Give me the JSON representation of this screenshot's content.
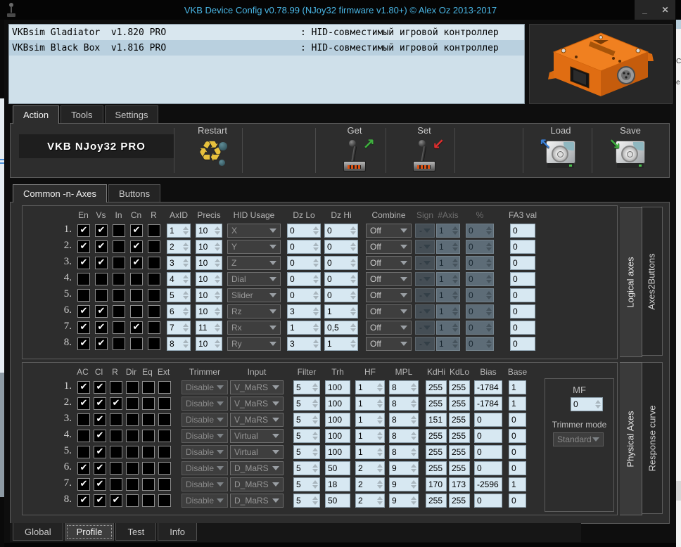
{
  "window": {
    "title": "VKB Device Config v0.78.99 (NJoy32 firmware v1.80+) © Alex Oz 2013-2017",
    "minimize_label": "_",
    "close_label": "✕"
  },
  "device_list": {
    "rows": [
      {
        "name": "VKBsim Gladiator  v1.820 PRO",
        "desc": ": HID-совместимый игровой контроллер"
      },
      {
        "name": "VKBsim Black Box  v1.816 PRO",
        "desc": ": HID-совместимый игровой контроллер"
      }
    ]
  },
  "top_tabs": {
    "items": [
      "Action",
      "Tools",
      "Settings"
    ],
    "active": "Action"
  },
  "toolbar": {
    "device_label": "VKB NJoy32 PRO",
    "restart_label": "Restart",
    "get_label": "Get",
    "set_label": "Set",
    "load_label": "Load",
    "save_label": "Save"
  },
  "main_tabs": {
    "items": [
      "Common -n- Axes",
      "Buttons"
    ],
    "active": "Common -n- Axes"
  },
  "axes_table": {
    "check_headers": [
      "En",
      "Vs",
      "In",
      "Cn",
      "R"
    ],
    "col_headers": [
      "AxID",
      "Precis",
      "HID Usage",
      "Dz Lo",
      "Dz Hi",
      "Combine",
      "Sign",
      "#Axis",
      "%",
      "FA3 val"
    ],
    "dim_headers": [
      "Sign",
      "#Axis",
      "%"
    ],
    "rows": [
      {
        "num": "1.",
        "checks": [
          1,
          1,
          0,
          1,
          0
        ],
        "axid": "1",
        "precis": "10",
        "hid": "X",
        "dzlo": "0",
        "dzhi": "0",
        "combine": "Off",
        "sign": "-",
        "naxis": "1",
        "pct": "0",
        "fa3": "0"
      },
      {
        "num": "2.",
        "checks": [
          1,
          1,
          0,
          1,
          0
        ],
        "axid": "2",
        "precis": "10",
        "hid": "Y",
        "dzlo": "0",
        "dzhi": "0",
        "combine": "Off",
        "sign": "-",
        "naxis": "1",
        "pct": "0",
        "fa3": "0"
      },
      {
        "num": "3.",
        "checks": [
          1,
          1,
          0,
          1,
          0
        ],
        "axid": "3",
        "precis": "10",
        "hid": "Z",
        "dzlo": "0",
        "dzhi": "0",
        "combine": "Off",
        "sign": "-",
        "naxis": "1",
        "pct": "0",
        "fa3": "0"
      },
      {
        "num": "4.",
        "checks": [
          0,
          0,
          0,
          0,
          0
        ],
        "axid": "4",
        "precis": "10",
        "hid": "Dial",
        "dzlo": "0",
        "dzhi": "0",
        "combine": "Off",
        "sign": "-",
        "naxis": "1",
        "pct": "0",
        "fa3": "0"
      },
      {
        "num": "5.",
        "checks": [
          0,
          0,
          0,
          0,
          0
        ],
        "axid": "5",
        "precis": "10",
        "hid": "Slider",
        "dzlo": "0",
        "dzhi": "0",
        "combine": "Off",
        "sign": "-",
        "naxis": "1",
        "pct": "0",
        "fa3": "0"
      },
      {
        "num": "6.",
        "checks": [
          1,
          1,
          0,
          0,
          0
        ],
        "axid": "6",
        "precis": "10",
        "hid": "Rz",
        "dzlo": "3",
        "dzhi": "1",
        "combine": "Off",
        "sign": "-",
        "naxis": "1",
        "pct": "0",
        "fa3": "0"
      },
      {
        "num": "7.",
        "checks": [
          1,
          1,
          0,
          1,
          0
        ],
        "axid": "7",
        "precis": "11",
        "hid": "Rx",
        "dzlo": "1",
        "dzhi": "0,5",
        "combine": "Off",
        "sign": "-",
        "naxis": "1",
        "pct": "0",
        "fa3": "0"
      },
      {
        "num": "8.",
        "checks": [
          1,
          1,
          0,
          0,
          0
        ],
        "axid": "8",
        "precis": "10",
        "hid": "Ry",
        "dzlo": "3",
        "dzhi": "1",
        "combine": "Off",
        "sign": "-",
        "naxis": "1",
        "pct": "0",
        "fa3": "0"
      }
    ]
  },
  "phys_table": {
    "check_headers": [
      "AC",
      "Cl",
      "R",
      "Dir",
      "Eq",
      "Ext"
    ],
    "col_headers": [
      "Trimmer",
      "Input",
      "Filter",
      "Trh",
      "HF",
      "MPL",
      "KdHi",
      "KdLo",
      "Bias",
      "Base"
    ],
    "rows": [
      {
        "num": "1.",
        "checks": [
          1,
          1,
          0,
          0,
          0,
          0
        ],
        "trimmer": "Disable",
        "input": "V_MaRS",
        "filter": "5",
        "trh": "100",
        "hf": "1",
        "mpl": "8",
        "kdhi": "255",
        "kdlo": "255",
        "bias": "-1784",
        "base": "1"
      },
      {
        "num": "2.",
        "checks": [
          1,
          1,
          1,
          0,
          0,
          0
        ],
        "trimmer": "Disable",
        "input": "V_MaRS",
        "filter": "5",
        "trh": "100",
        "hf": "1",
        "mpl": "8",
        "kdhi": "255",
        "kdlo": "255",
        "bias": "-1784",
        "base": "1"
      },
      {
        "num": "3.",
        "checks": [
          0,
          1,
          0,
          0,
          0,
          0
        ],
        "trimmer": "Disable",
        "input": "V_MaRS",
        "filter": "5",
        "trh": "100",
        "hf": "1",
        "mpl": "8",
        "kdhi": "151",
        "kdlo": "255",
        "bias": "0",
        "base": "0"
      },
      {
        "num": "4.",
        "checks": [
          0,
          1,
          0,
          0,
          0,
          0
        ],
        "trimmer": "Disable",
        "input": "Virtual",
        "filter": "5",
        "trh": "100",
        "hf": "1",
        "mpl": "8",
        "kdhi": "255",
        "kdlo": "255",
        "bias": "0",
        "base": "0"
      },
      {
        "num": "5.",
        "checks": [
          0,
          1,
          0,
          0,
          0,
          0
        ],
        "trimmer": "Disable",
        "input": "Virtual",
        "filter": "5",
        "trh": "100",
        "hf": "1",
        "mpl": "8",
        "kdhi": "255",
        "kdlo": "255",
        "bias": "0",
        "base": "0"
      },
      {
        "num": "6.",
        "checks": [
          1,
          1,
          0,
          0,
          0,
          0
        ],
        "trimmer": "Disable",
        "input": "D_MaRS",
        "filter": "5",
        "trh": "50",
        "hf": "2",
        "mpl": "9",
        "kdhi": "255",
        "kdlo": "255",
        "bias": "0",
        "base": "0"
      },
      {
        "num": "7.",
        "checks": [
          1,
          1,
          0,
          0,
          0,
          0
        ],
        "trimmer": "Disable",
        "input": "D_MaRS",
        "filter": "5",
        "trh": "18",
        "hf": "2",
        "mpl": "9",
        "kdhi": "170",
        "kdlo": "173",
        "bias": "-2596",
        "base": "1"
      },
      {
        "num": "8.",
        "checks": [
          1,
          1,
          1,
          0,
          0,
          0
        ],
        "trimmer": "Disable",
        "input": "D_MaRS",
        "filter": "5",
        "trh": "50",
        "hf": "2",
        "mpl": "9",
        "kdhi": "255",
        "kdlo": "255",
        "bias": "0",
        "base": "0"
      }
    ]
  },
  "mf_panel": {
    "label": "MF",
    "value": "0",
    "mode_label": "Trimmer mode",
    "mode_value": "Standard"
  },
  "side_tabs": {
    "top_active": "Logical axes",
    "top_inactive": "Axes2Buttons",
    "bottom_active": "Physical Axes",
    "bottom_inactive": "Response curve"
  },
  "bottom_tabs": {
    "items": [
      "Global",
      "Profile",
      "Test",
      "Info"
    ],
    "active": "Profile"
  },
  "icons": {
    "restart": "recycle-icon",
    "get": "joystick-arrow-out-icon",
    "set": "joystick-arrow-in-icon",
    "load": "harddisk-arrow-out-icon",
    "save": "harddisk-arrow-in-icon"
  },
  "colors": {
    "title_text": "#4ab7e6",
    "input_blue": "#d7e8f2",
    "panel_bg": "#2d2d2d",
    "device_orange": "#e87511",
    "list_row_selected": "#b9d0df"
  }
}
